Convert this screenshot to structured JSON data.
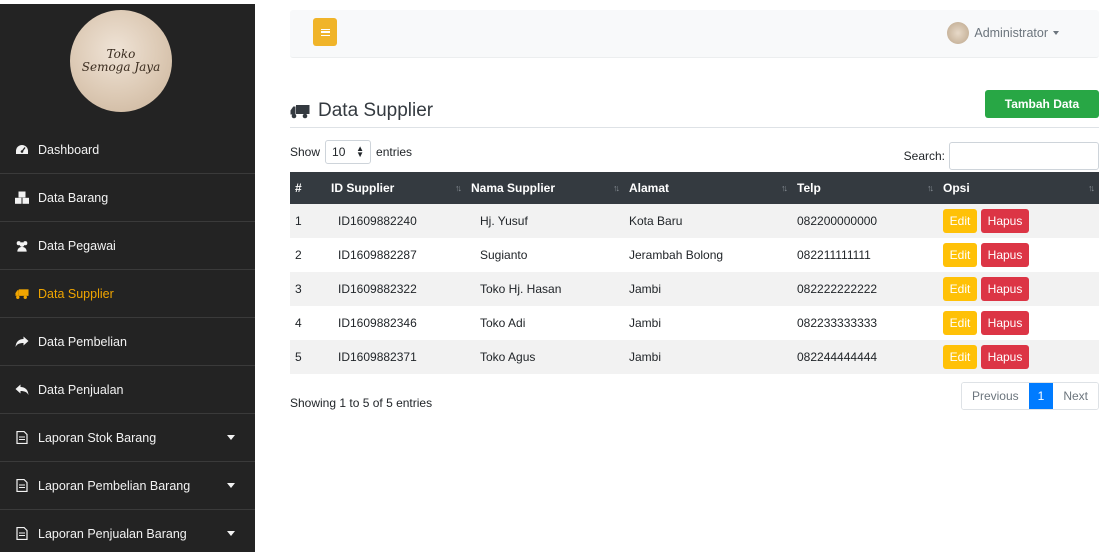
{
  "brand": {
    "logo_line1": "Toko",
    "logo_line2": "Semoga Jaya"
  },
  "sidebar": {
    "items": [
      {
        "label": "Dashboard",
        "icon": "tachometer-icon"
      },
      {
        "label": "Data Barang",
        "icon": "cubes-icon"
      },
      {
        "label": "Data Pegawai",
        "icon": "users-icon"
      },
      {
        "label": "Data Supplier",
        "icon": "truck-icon",
        "active": true
      },
      {
        "label": "Data Pembelian",
        "icon": "share-arrow-icon"
      },
      {
        "label": "Data Penjualan",
        "icon": "reply-arrow-icon"
      },
      {
        "label": "Laporan Stok Barang",
        "icon": "file-icon",
        "dropdown": true
      },
      {
        "label": "Laporan Pembelian Barang",
        "icon": "file-icon",
        "dropdown": true
      },
      {
        "label": "Laporan Penjualan Barang",
        "icon": "file-icon",
        "dropdown": true
      }
    ]
  },
  "topbar": {
    "user_label": "Administrator"
  },
  "page": {
    "title": "Data Supplier",
    "add_button": "Tambah Data"
  },
  "table_controls": {
    "show_label": "Show",
    "length_value": "10",
    "entries_label": "entries",
    "search_label": "Search:",
    "search_value": ""
  },
  "table": {
    "headers": [
      "#",
      "ID Supplier",
      "Nama Supplier",
      "Alamat",
      "Telp",
      "Opsi"
    ],
    "rows": [
      {
        "no": "1",
        "id": "ID1609882240",
        "nama": "Hj. Yusuf",
        "alamat": "Kota Baru",
        "telp": "082200000000"
      },
      {
        "no": "2",
        "id": "ID1609882287",
        "nama": "Sugianto",
        "alamat": "Jerambah Bolong",
        "telp": "082211111111"
      },
      {
        "no": "3",
        "id": "ID1609882322",
        "nama": "Toko Hj. Hasan",
        "alamat": "Jambi",
        "telp": "082222222222"
      },
      {
        "no": "4",
        "id": "ID1609882346",
        "nama": "Toko Adi",
        "alamat": "Jambi",
        "telp": "082233333333"
      },
      {
        "no": "5",
        "id": "ID1609882371",
        "nama": "Toko Agus",
        "alamat": "Jambi",
        "telp": "082244444444"
      }
    ],
    "edit_label": "Edit",
    "delete_label": "Hapus"
  },
  "footer": {
    "info": "Showing 1 to 5 of 5 entries",
    "prev": "Previous",
    "current_page": "1",
    "next": "Next"
  },
  "colors": {
    "sidebar_bg": "#232323",
    "active": "#f0a500",
    "header_bg": "#343a40",
    "add": "#28a745",
    "edit": "#ffc107",
    "delete": "#dc3545",
    "page_active": "#007bff"
  }
}
